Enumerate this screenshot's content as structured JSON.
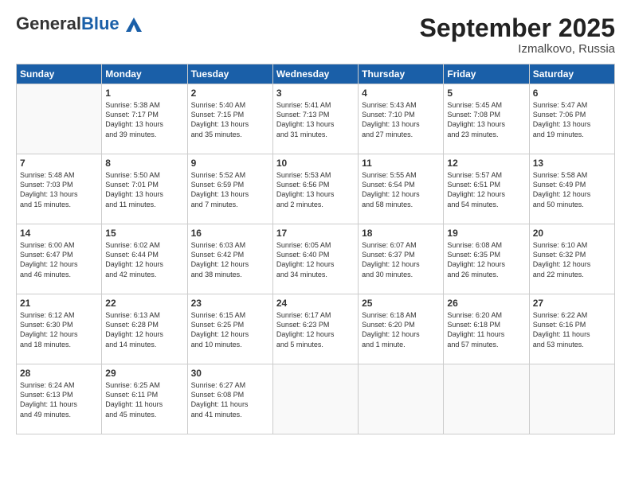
{
  "logo": {
    "general": "General",
    "blue": "Blue"
  },
  "title": "September 2025",
  "subtitle": "Izmalkovo, Russia",
  "days_header": [
    "Sunday",
    "Monday",
    "Tuesday",
    "Wednesday",
    "Thursday",
    "Friday",
    "Saturday"
  ],
  "weeks": [
    [
      {
        "day": "",
        "info": ""
      },
      {
        "day": "1",
        "info": "Sunrise: 5:38 AM\nSunset: 7:17 PM\nDaylight: 13 hours\nand 39 minutes."
      },
      {
        "day": "2",
        "info": "Sunrise: 5:40 AM\nSunset: 7:15 PM\nDaylight: 13 hours\nand 35 minutes."
      },
      {
        "day": "3",
        "info": "Sunrise: 5:41 AM\nSunset: 7:13 PM\nDaylight: 13 hours\nand 31 minutes."
      },
      {
        "day": "4",
        "info": "Sunrise: 5:43 AM\nSunset: 7:10 PM\nDaylight: 13 hours\nand 27 minutes."
      },
      {
        "day": "5",
        "info": "Sunrise: 5:45 AM\nSunset: 7:08 PM\nDaylight: 13 hours\nand 23 minutes."
      },
      {
        "day": "6",
        "info": "Sunrise: 5:47 AM\nSunset: 7:06 PM\nDaylight: 13 hours\nand 19 minutes."
      }
    ],
    [
      {
        "day": "7",
        "info": "Sunrise: 5:48 AM\nSunset: 7:03 PM\nDaylight: 13 hours\nand 15 minutes."
      },
      {
        "day": "8",
        "info": "Sunrise: 5:50 AM\nSunset: 7:01 PM\nDaylight: 13 hours\nand 11 minutes."
      },
      {
        "day": "9",
        "info": "Sunrise: 5:52 AM\nSunset: 6:59 PM\nDaylight: 13 hours\nand 7 minutes."
      },
      {
        "day": "10",
        "info": "Sunrise: 5:53 AM\nSunset: 6:56 PM\nDaylight: 13 hours\nand 2 minutes."
      },
      {
        "day": "11",
        "info": "Sunrise: 5:55 AM\nSunset: 6:54 PM\nDaylight: 12 hours\nand 58 minutes."
      },
      {
        "day": "12",
        "info": "Sunrise: 5:57 AM\nSunset: 6:51 PM\nDaylight: 12 hours\nand 54 minutes."
      },
      {
        "day": "13",
        "info": "Sunrise: 5:58 AM\nSunset: 6:49 PM\nDaylight: 12 hours\nand 50 minutes."
      }
    ],
    [
      {
        "day": "14",
        "info": "Sunrise: 6:00 AM\nSunset: 6:47 PM\nDaylight: 12 hours\nand 46 minutes."
      },
      {
        "day": "15",
        "info": "Sunrise: 6:02 AM\nSunset: 6:44 PM\nDaylight: 12 hours\nand 42 minutes."
      },
      {
        "day": "16",
        "info": "Sunrise: 6:03 AM\nSunset: 6:42 PM\nDaylight: 12 hours\nand 38 minutes."
      },
      {
        "day": "17",
        "info": "Sunrise: 6:05 AM\nSunset: 6:40 PM\nDaylight: 12 hours\nand 34 minutes."
      },
      {
        "day": "18",
        "info": "Sunrise: 6:07 AM\nSunset: 6:37 PM\nDaylight: 12 hours\nand 30 minutes."
      },
      {
        "day": "19",
        "info": "Sunrise: 6:08 AM\nSunset: 6:35 PM\nDaylight: 12 hours\nand 26 minutes."
      },
      {
        "day": "20",
        "info": "Sunrise: 6:10 AM\nSunset: 6:32 PM\nDaylight: 12 hours\nand 22 minutes."
      }
    ],
    [
      {
        "day": "21",
        "info": "Sunrise: 6:12 AM\nSunset: 6:30 PM\nDaylight: 12 hours\nand 18 minutes."
      },
      {
        "day": "22",
        "info": "Sunrise: 6:13 AM\nSunset: 6:28 PM\nDaylight: 12 hours\nand 14 minutes."
      },
      {
        "day": "23",
        "info": "Sunrise: 6:15 AM\nSunset: 6:25 PM\nDaylight: 12 hours\nand 10 minutes."
      },
      {
        "day": "24",
        "info": "Sunrise: 6:17 AM\nSunset: 6:23 PM\nDaylight: 12 hours\nand 5 minutes."
      },
      {
        "day": "25",
        "info": "Sunrise: 6:18 AM\nSunset: 6:20 PM\nDaylight: 12 hours\nand 1 minute."
      },
      {
        "day": "26",
        "info": "Sunrise: 6:20 AM\nSunset: 6:18 PM\nDaylight: 11 hours\nand 57 minutes."
      },
      {
        "day": "27",
        "info": "Sunrise: 6:22 AM\nSunset: 6:16 PM\nDaylight: 11 hours\nand 53 minutes."
      }
    ],
    [
      {
        "day": "28",
        "info": "Sunrise: 6:24 AM\nSunset: 6:13 PM\nDaylight: 11 hours\nand 49 minutes."
      },
      {
        "day": "29",
        "info": "Sunrise: 6:25 AM\nSunset: 6:11 PM\nDaylight: 11 hours\nand 45 minutes."
      },
      {
        "day": "30",
        "info": "Sunrise: 6:27 AM\nSunset: 6:08 PM\nDaylight: 11 hours\nand 41 minutes."
      },
      {
        "day": "",
        "info": ""
      },
      {
        "day": "",
        "info": ""
      },
      {
        "day": "",
        "info": ""
      },
      {
        "day": "",
        "info": ""
      }
    ]
  ]
}
